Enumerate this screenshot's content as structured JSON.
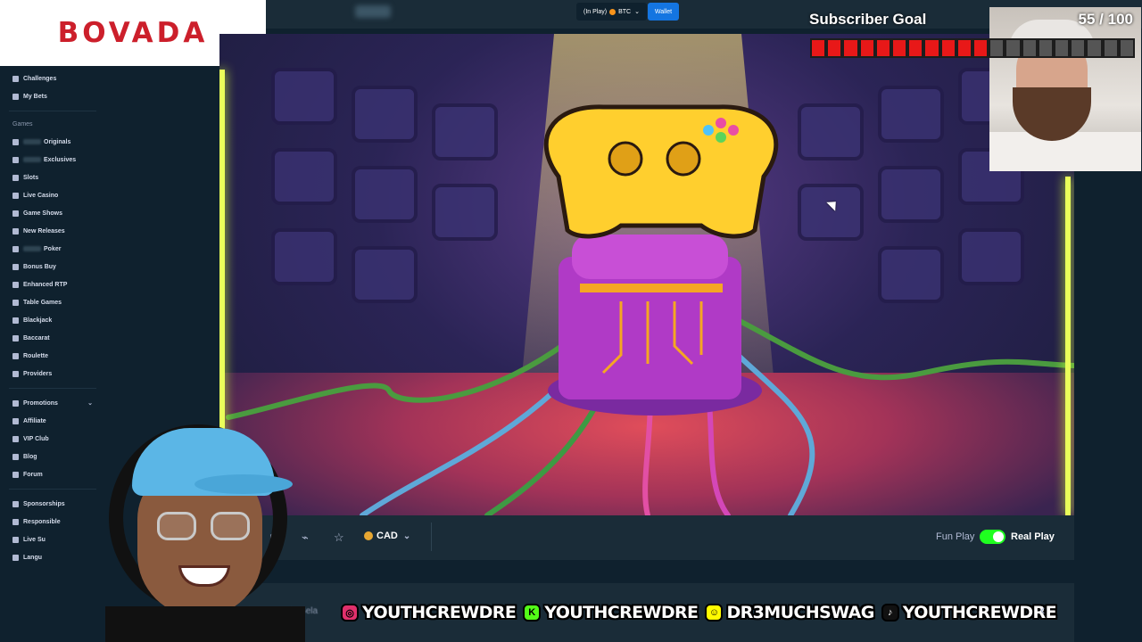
{
  "logo": {
    "text": "BOVADA"
  },
  "header": {
    "balance_label": "(In Play)",
    "currency": "BTC",
    "wallet_label": "Wallet"
  },
  "sidebar": {
    "items_top": [
      {
        "label": "Challenges"
      },
      {
        "label": "My Bets"
      }
    ],
    "games_heading": "Games",
    "games": [
      {
        "label": "Originals"
      },
      {
        "label": "Exclusives"
      },
      {
        "label": "Slots"
      },
      {
        "label": "Live Casino"
      },
      {
        "label": "Game Shows"
      },
      {
        "label": "New Releases"
      },
      {
        "label": "Poker"
      },
      {
        "label": "Bonus Buy"
      },
      {
        "label": "Enhanced RTP"
      },
      {
        "label": "Table Games"
      },
      {
        "label": "Blackjack"
      },
      {
        "label": "Baccarat"
      },
      {
        "label": "Roulette"
      },
      {
        "label": "Providers"
      }
    ],
    "more": [
      {
        "label": "Promotions"
      },
      {
        "label": "Affiliate"
      },
      {
        "label": "VIP Club"
      },
      {
        "label": "Blog"
      },
      {
        "label": "Forum"
      }
    ],
    "bottom": [
      {
        "label": "Sponsorships"
      },
      {
        "label": "Responsible"
      },
      {
        "label": "Live Su"
      },
      {
        "label": "Langu"
      }
    ]
  },
  "gamebar": {
    "currency": "CAD",
    "fun_play_label": "Fun Play",
    "real_play_label": "Real Play",
    "real_play_on": true
  },
  "below": {
    "text": "Cyber Crusade  Bela"
  },
  "subscriber_goal": {
    "title": "Subscriber Goal",
    "count": "55 / 100",
    "current": 55,
    "target": 100
  },
  "socials": [
    {
      "icon": "instagram-icon",
      "handle": "YOUTHCREWDRE",
      "color": "#e1306c"
    },
    {
      "icon": "kick-icon",
      "handle": "YOUTHCREWDRE",
      "color": "#53fc18"
    },
    {
      "icon": "snapchat-icon",
      "handle": "DR3MUCHSWAG",
      "color": "#fffc00"
    },
    {
      "icon": "tiktok-icon",
      "handle": "YOUTHCREWDRE",
      "color": "#111111"
    }
  ],
  "colors": {
    "brand": "#cc1f2b",
    "wallet": "#1475e1",
    "toggle_on": "#1fff20",
    "goal_fill": "#e81818"
  }
}
